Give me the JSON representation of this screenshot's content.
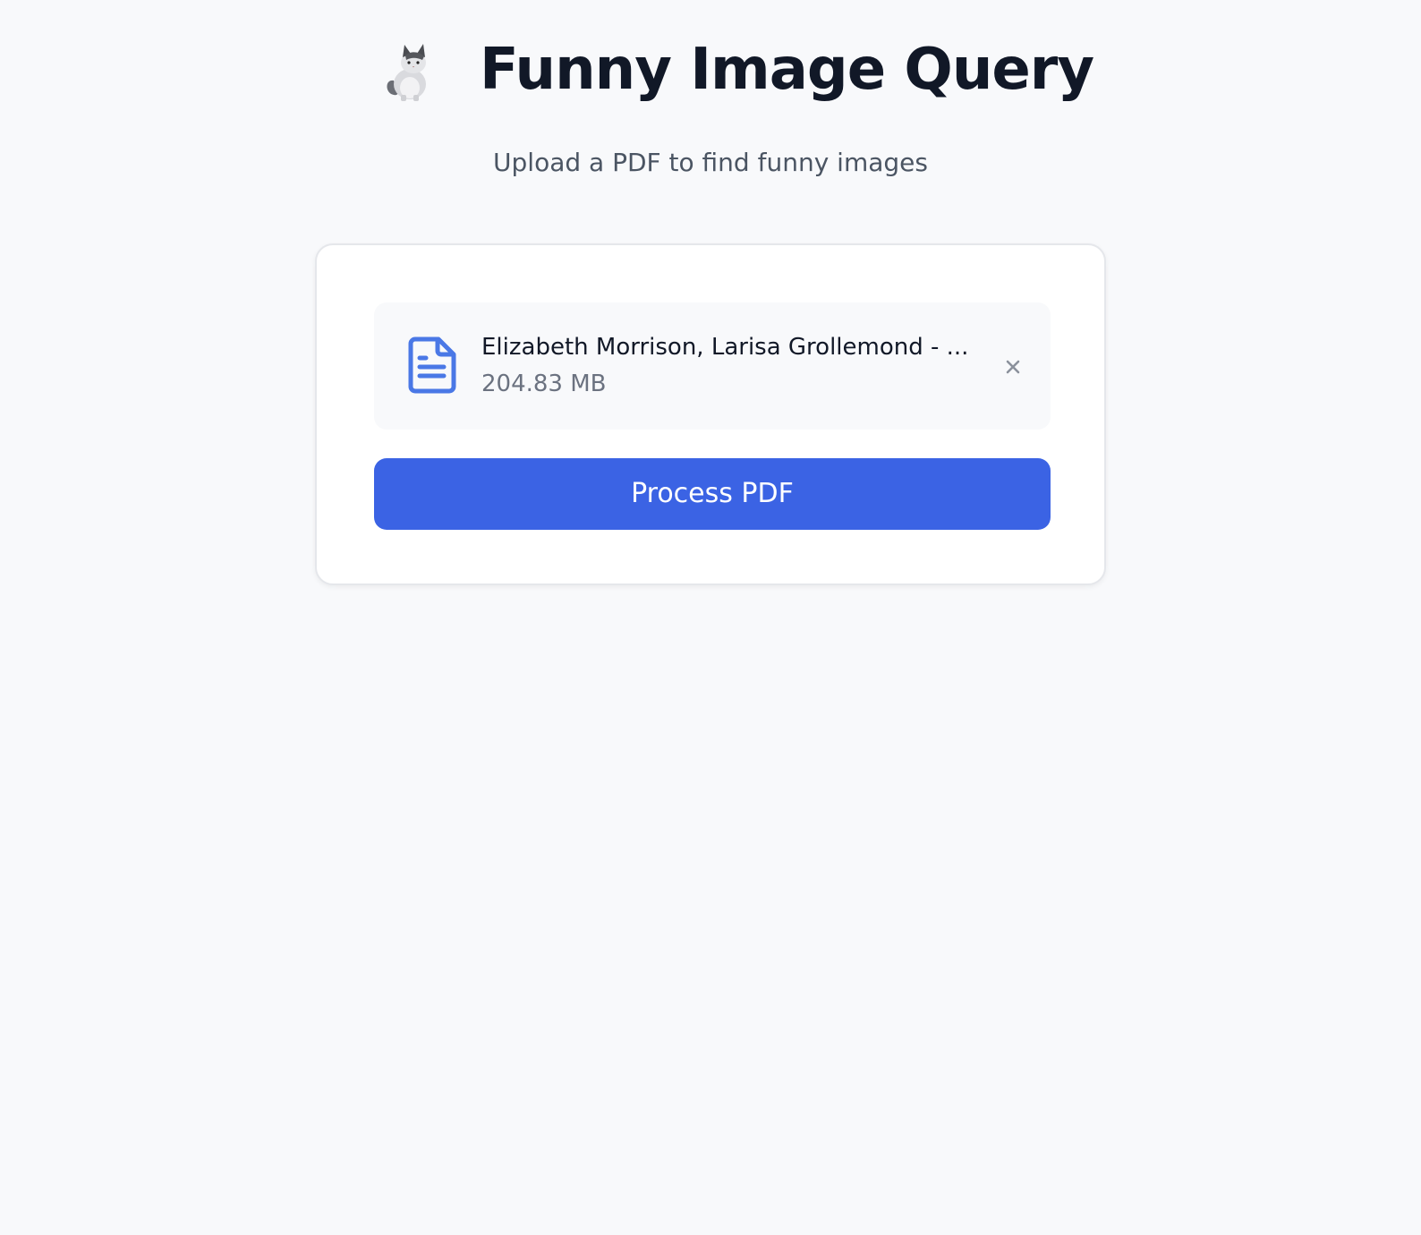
{
  "header": {
    "title": "Funny Image Query",
    "logo_icon": "cat-icon",
    "subtitle": "Upload a PDF to find funny images"
  },
  "upload_card": {
    "file": {
      "icon": "document-icon",
      "name": "Elizabeth Morrison, Larisa Grollemond - ...",
      "size": "204.83 MB",
      "remove_icon": "close-icon"
    },
    "process_button_label": "Process PDF"
  },
  "colors": {
    "background": "#f8f9fb",
    "accent": "#3b63e4",
    "file_icon": "#4a78e6",
    "title": "#111827",
    "muted": "#6b7280"
  }
}
